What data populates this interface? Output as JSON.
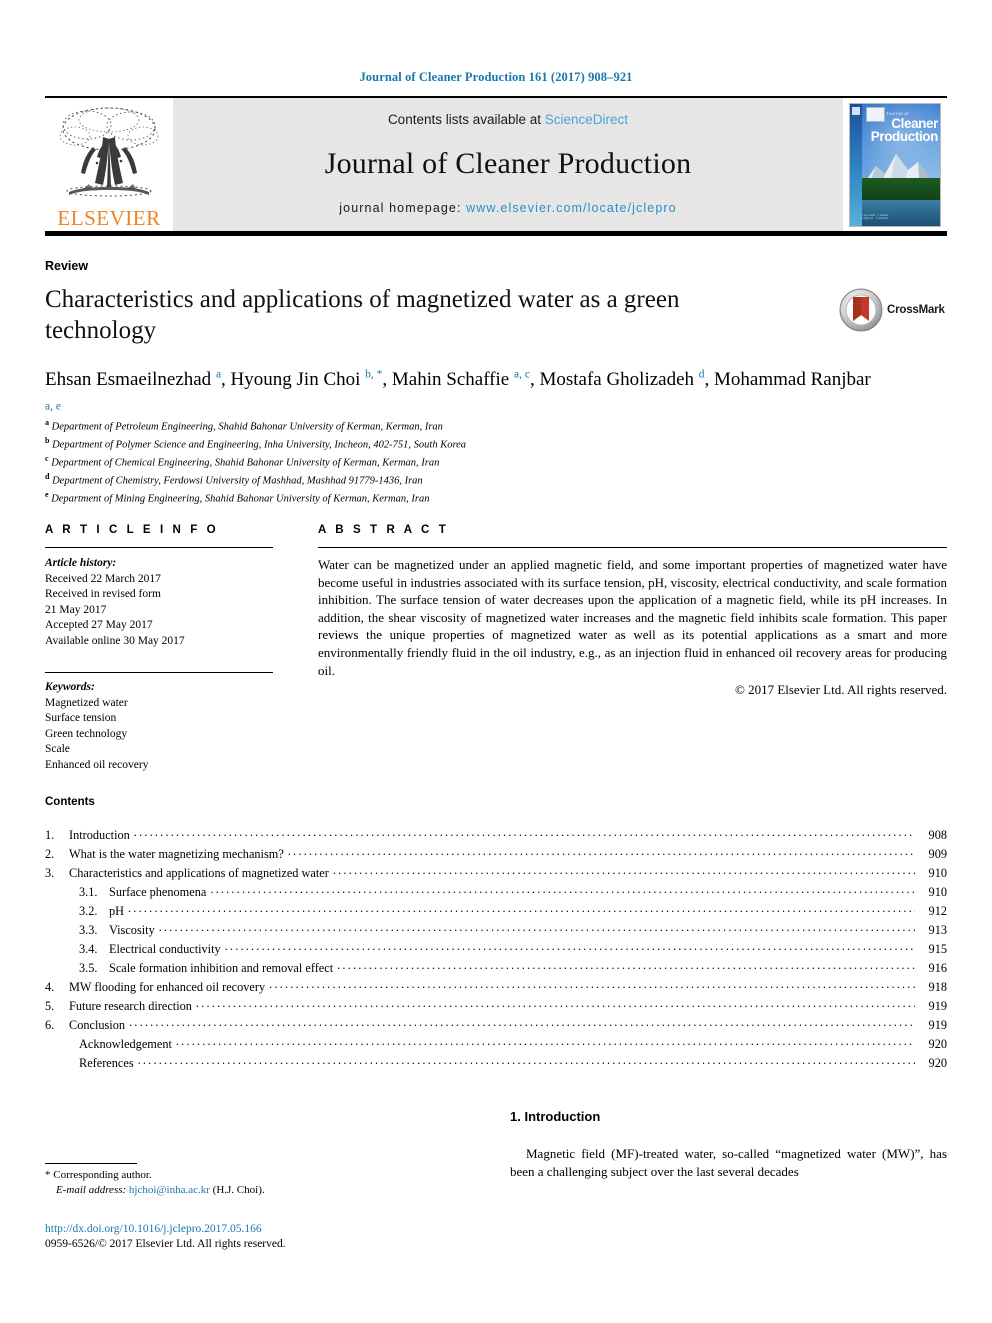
{
  "running_head": "Journal of Cleaner Production 161 (2017) 908–921",
  "masthead": {
    "contents_prefix": "Contents lists available at ",
    "sciencedirect": "ScienceDirect",
    "journal_name": "Journal of Cleaner Production",
    "homepage_prefix": "journal homepage: ",
    "homepage_url": "www.elsevier.com/locate/jclepro",
    "publisher": "ELSEVIER",
    "publisher_color": "#f08222",
    "link_color": "#4aa3d6",
    "band_color": "#e6e6e6",
    "cover": {
      "small_title": "Journal of",
      "line1": "Cleaner",
      "line2": "Production"
    }
  },
  "article": {
    "type": "Review",
    "title": "Characteristics and applications of magnetized water as a green technology",
    "crossmark_label": "CrossMark",
    "authors_html": "Ehsan Esmaeilnezhad <sup>a</sup>, Hyoung Jin Choi <sup>b, *</sup>, Mahin Schaffie <sup>a, c</sup>, Mostafa Gholizadeh <sup>d</sup>, Mohammad Ranjbar <sup>a, e</sup>",
    "affiliations": [
      {
        "mark": "a",
        "text": "Department of Petroleum Engineering, Shahid Bahonar University of Kerman, Kerman, Iran"
      },
      {
        "mark": "b",
        "text": "Department of Polymer Science and Engineering, Inha University, Incheon, 402-751, South Korea"
      },
      {
        "mark": "c",
        "text": "Department of Chemical Engineering, Shahid Bahonar University of Kerman, Kerman, Iran"
      },
      {
        "mark": "d",
        "text": "Department of Chemistry, Ferdowsi University of Mashhad, Mashhad 91779-1436, Iran"
      },
      {
        "mark": "e",
        "text": "Department of Mining Engineering, Shahid Bahonar University of Kerman, Kerman, Iran"
      }
    ]
  },
  "article_info": {
    "heading": "A R T I C L E  I N F O",
    "history_label": "Article history:",
    "history": [
      "Received 22 March 2017",
      "Received in revised form",
      "21 May 2017",
      "Accepted 27 May 2017",
      "Available online 30 May 2017"
    ],
    "keywords_label": "Keywords:",
    "keywords": [
      "Magnetized water",
      "Surface tension",
      "Green technology",
      "Scale",
      "Enhanced oil recovery"
    ]
  },
  "abstract": {
    "heading": "A B S T R A C T",
    "body": "Water can be magnetized under an applied magnetic field, and some important properties of magnetized water have become useful in industries associated with its surface tension, pH, viscosity, electrical conductivity, and scale formation inhibition. The surface tension of water decreases upon the application of a magnetic field, while its pH increases. In addition, the shear viscosity of magnetized water increases and the magnetic field inhibits scale formation. This paper reviews the unique properties of magnetized water as well as its potential applications as a smart and more environmentally friendly fluid in the oil industry, e.g., as an injection fluid in enhanced oil recovery areas for producing oil.",
    "copyright": "© 2017 Elsevier Ltd. All rights reserved."
  },
  "contents": {
    "heading": "Contents",
    "items": [
      {
        "num": "1.",
        "sub": "",
        "label": "Introduction",
        "page": "908",
        "level": 1
      },
      {
        "num": "2.",
        "sub": "",
        "label": "What is the water magnetizing mechanism?",
        "page": "909",
        "level": 1
      },
      {
        "num": "3.",
        "sub": "",
        "label": "Characteristics and applications of magnetized water",
        "page": "910",
        "level": 1
      },
      {
        "num": "",
        "sub": "3.1.",
        "label": "Surface phenomena",
        "page": "910",
        "level": 2
      },
      {
        "num": "",
        "sub": "3.2.",
        "label": "pH",
        "page": "912",
        "level": 2
      },
      {
        "num": "",
        "sub": "3.3.",
        "label": "Viscosity",
        "page": "913",
        "level": 2
      },
      {
        "num": "",
        "sub": "3.4.",
        "label": "Electrical conductivity",
        "page": "915",
        "level": 2
      },
      {
        "num": "",
        "sub": "3.5.",
        "label": "Scale formation inhibition and removal effect",
        "page": "916",
        "level": 2
      },
      {
        "num": "4.",
        "sub": "",
        "label": "MW flooding for enhanced oil recovery",
        "page": "918",
        "level": 1
      },
      {
        "num": "5.",
        "sub": "",
        "label": "Future research direction",
        "page": "919",
        "level": 1
      },
      {
        "num": "6.",
        "sub": "",
        "label": "Conclusion",
        "page": "919",
        "level": 1
      },
      {
        "num": "",
        "sub": "",
        "label": "Acknowledgement",
        "page": "920",
        "level": 3
      },
      {
        "num": "",
        "sub": "",
        "label": "References",
        "page": "920",
        "level": 3
      }
    ]
  },
  "introduction": {
    "heading": "1. Introduction",
    "paragraph": "Magnetic field (MF)-treated water, so-called “magnetized water (MW)”, has been a challenging subject over the last several decades"
  },
  "footer": {
    "corresponding_marker": "*",
    "corresponding_text": "Corresponding author.",
    "email_label": "E-mail address:",
    "email": "hjchoi@inha.ac.kr",
    "email_owner": "(H.J. Choi).",
    "doi": "http://dx.doi.org/10.1016/j.jclepro.2017.05.166",
    "issn_line": "0959-6526/© 2017 Elsevier Ltd. All rights reserved."
  }
}
